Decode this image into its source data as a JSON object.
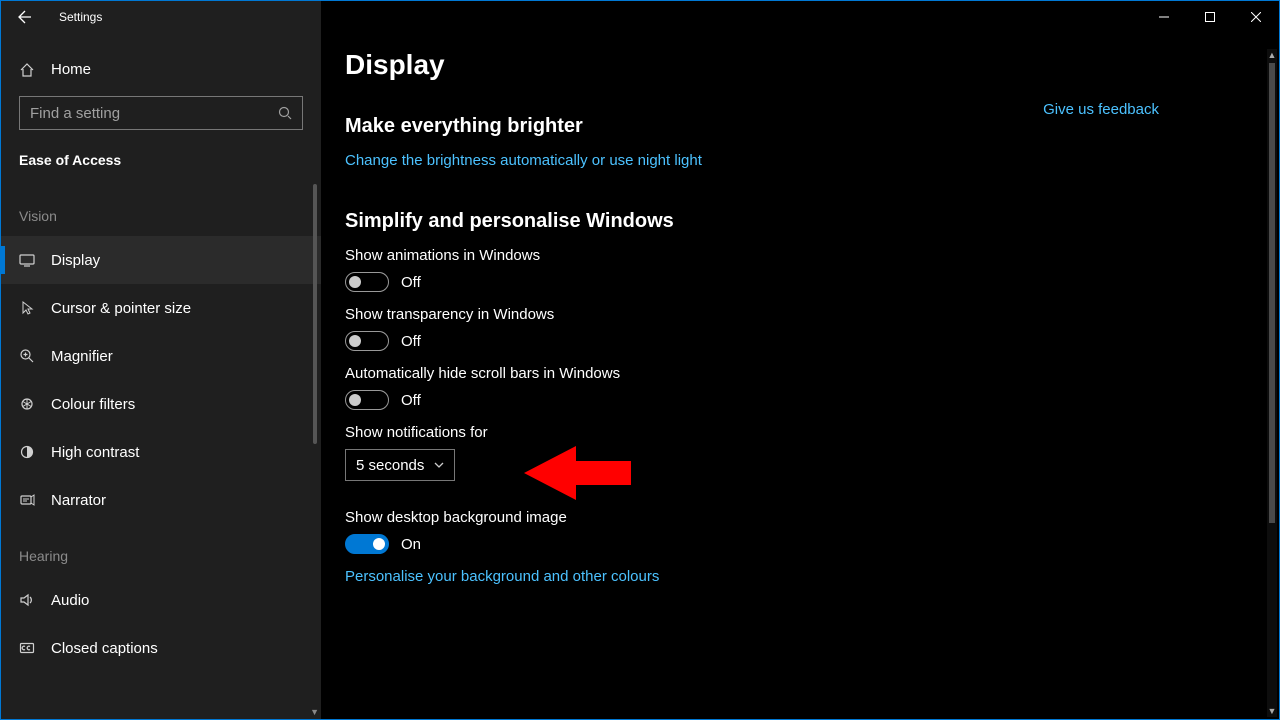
{
  "window": {
    "title": "Settings"
  },
  "sidebar": {
    "home": "Home",
    "search_placeholder": "Find a setting",
    "group": "Ease of Access",
    "groups": [
      {
        "heading": "Vision",
        "items": [
          {
            "label": "Display",
            "icon": "display-icon",
            "active": true
          },
          {
            "label": "Cursor & pointer size",
            "icon": "cursor-icon"
          },
          {
            "label": "Magnifier",
            "icon": "magnifier-icon"
          },
          {
            "label": "Colour filters",
            "icon": "colourfilters-icon"
          },
          {
            "label": "High contrast",
            "icon": "highcontrast-icon"
          },
          {
            "label": "Narrator",
            "icon": "narrator-icon"
          }
        ]
      },
      {
        "heading": "Hearing",
        "items": [
          {
            "label": "Audio",
            "icon": "audio-icon"
          },
          {
            "label": "Closed captions",
            "icon": "cc-icon"
          }
        ]
      }
    ]
  },
  "content": {
    "page_title": "Display",
    "feedback": "Give us feedback",
    "section_brighter": {
      "heading": "Make everything brighter",
      "link": "Change the brightness automatically or use night light"
    },
    "section_simplify": {
      "heading": "Simplify and personalise Windows",
      "animations": {
        "label": "Show animations in Windows",
        "state": "Off",
        "on": false
      },
      "transparency": {
        "label": "Show transparency in Windows",
        "state": "Off",
        "on": false
      },
      "scrollbars": {
        "label": "Automatically hide scroll bars in Windows",
        "state": "Off",
        "on": false
      },
      "notifications": {
        "label": "Show notifications for",
        "value": "5 seconds"
      },
      "desktop_bg": {
        "label": "Show desktop background image",
        "state": "On",
        "on": true
      },
      "personalise_link": "Personalise your background and other colours"
    }
  }
}
